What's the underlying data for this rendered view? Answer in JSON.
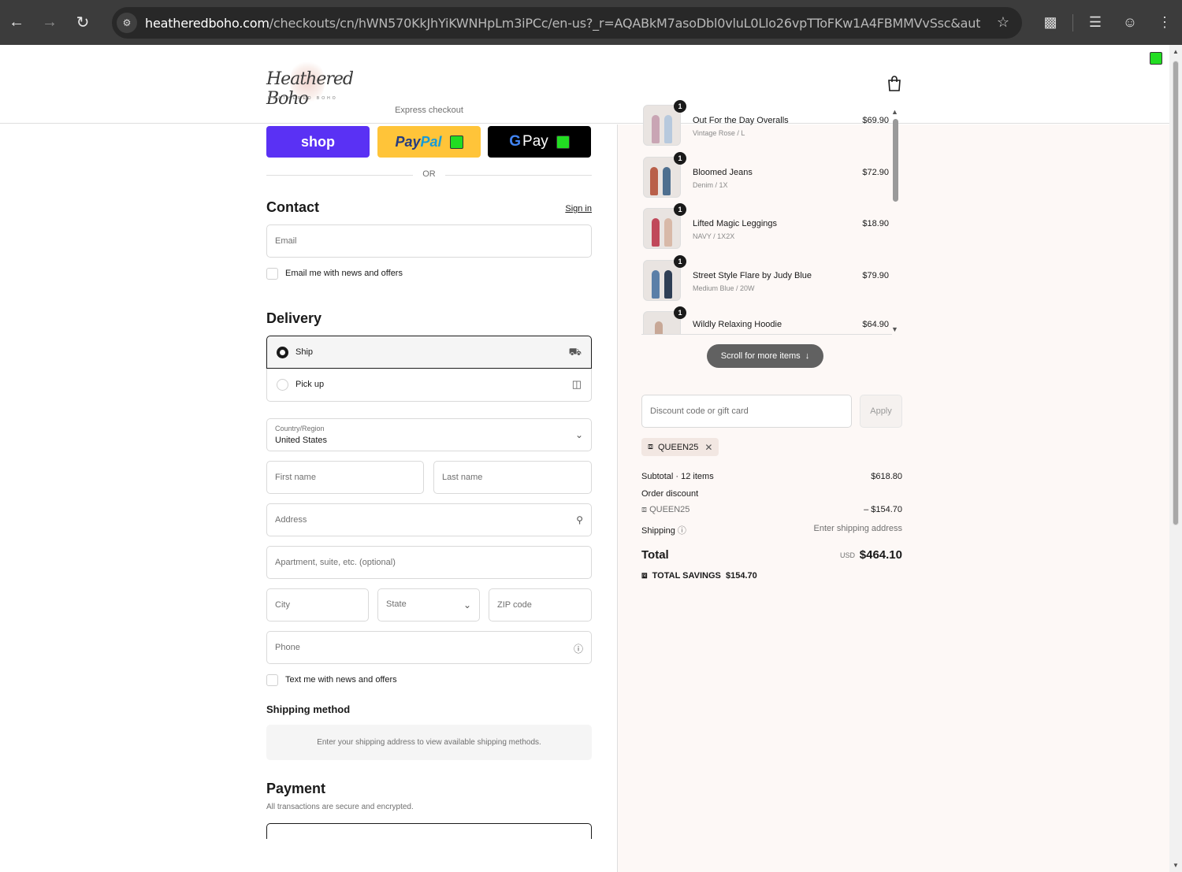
{
  "browser": {
    "url_host": "heatheredboho.com",
    "url_path": "/checkouts/cn/hWN570KkJhYiKWNHpLm3iPCc/en-us?_r=AQABkM7asoDbl0vluL0Llo26vpTToFKw1A4FBMMVvSsc&auto_redi..."
  },
  "header": {
    "logo_text": "Heathered Boho",
    "logo_subtext": "HEATHERED BOHO"
  },
  "express": {
    "title": "Express checkout",
    "shop_label": "shop",
    "paypal_label_1": "Pay",
    "paypal_label_2": "Pal",
    "gpay_g": "G",
    "gpay_label": "Pay",
    "or_label": "OR"
  },
  "contact": {
    "title": "Contact",
    "sign_in": "Sign in",
    "email_placeholder": "Email",
    "news_label": "Email me with news and offers"
  },
  "delivery": {
    "title": "Delivery",
    "options": [
      {
        "label": "Ship",
        "selected": true
      },
      {
        "label": "Pick up",
        "selected": false
      }
    ],
    "country_label": "Country/Region",
    "country_value": "United States",
    "first_name": "First name",
    "last_name": "Last name",
    "address": "Address",
    "apartment": "Apartment, suite, etc. (optional)",
    "city": "City",
    "state": "State",
    "zip": "ZIP code",
    "phone": "Phone",
    "text_label": "Text me with news and offers"
  },
  "shipping_method": {
    "title": "Shipping method",
    "message": "Enter your shipping address to view available shipping methods."
  },
  "payment": {
    "title": "Payment",
    "subtitle": "All transactions are secure and encrypted."
  },
  "order": {
    "items": [
      {
        "qty": "1",
        "name": "Out For the Day Overalls",
        "variant": "Vintage Rose / L",
        "price": "$69.90"
      },
      {
        "qty": "1",
        "name": "Bloomed Jeans",
        "variant": "Denim / 1X",
        "price": "$72.90"
      },
      {
        "qty": "1",
        "name": "Lifted Magic Leggings",
        "variant": "NAVY / 1X2X",
        "price": "$18.90"
      },
      {
        "qty": "1",
        "name": "Street Style Flare by Judy Blue",
        "variant": "Medium Blue / 20W",
        "price": "$79.90"
      },
      {
        "qty": "1",
        "name": "Wildly Relaxing Hoodie",
        "variant": "",
        "price": "$64.90"
      }
    ],
    "scroll_hint": "Scroll for more items",
    "discount_placeholder": "Discount code or gift card",
    "apply_label": "Apply",
    "applied_code": "QUEEN25",
    "subtotal_label": "Subtotal · 12 items",
    "subtotal_value": "$618.80",
    "order_discount_label": "Order discount",
    "discount_code": "QUEEN25",
    "discount_value": "– $154.70",
    "shipping_label": "Shipping",
    "shipping_value": "Enter shipping address",
    "total_label": "Total",
    "total_currency": "USD",
    "total_value": "$464.10",
    "savings_label": "TOTAL SAVINGS",
    "savings_value": "$154.70"
  }
}
